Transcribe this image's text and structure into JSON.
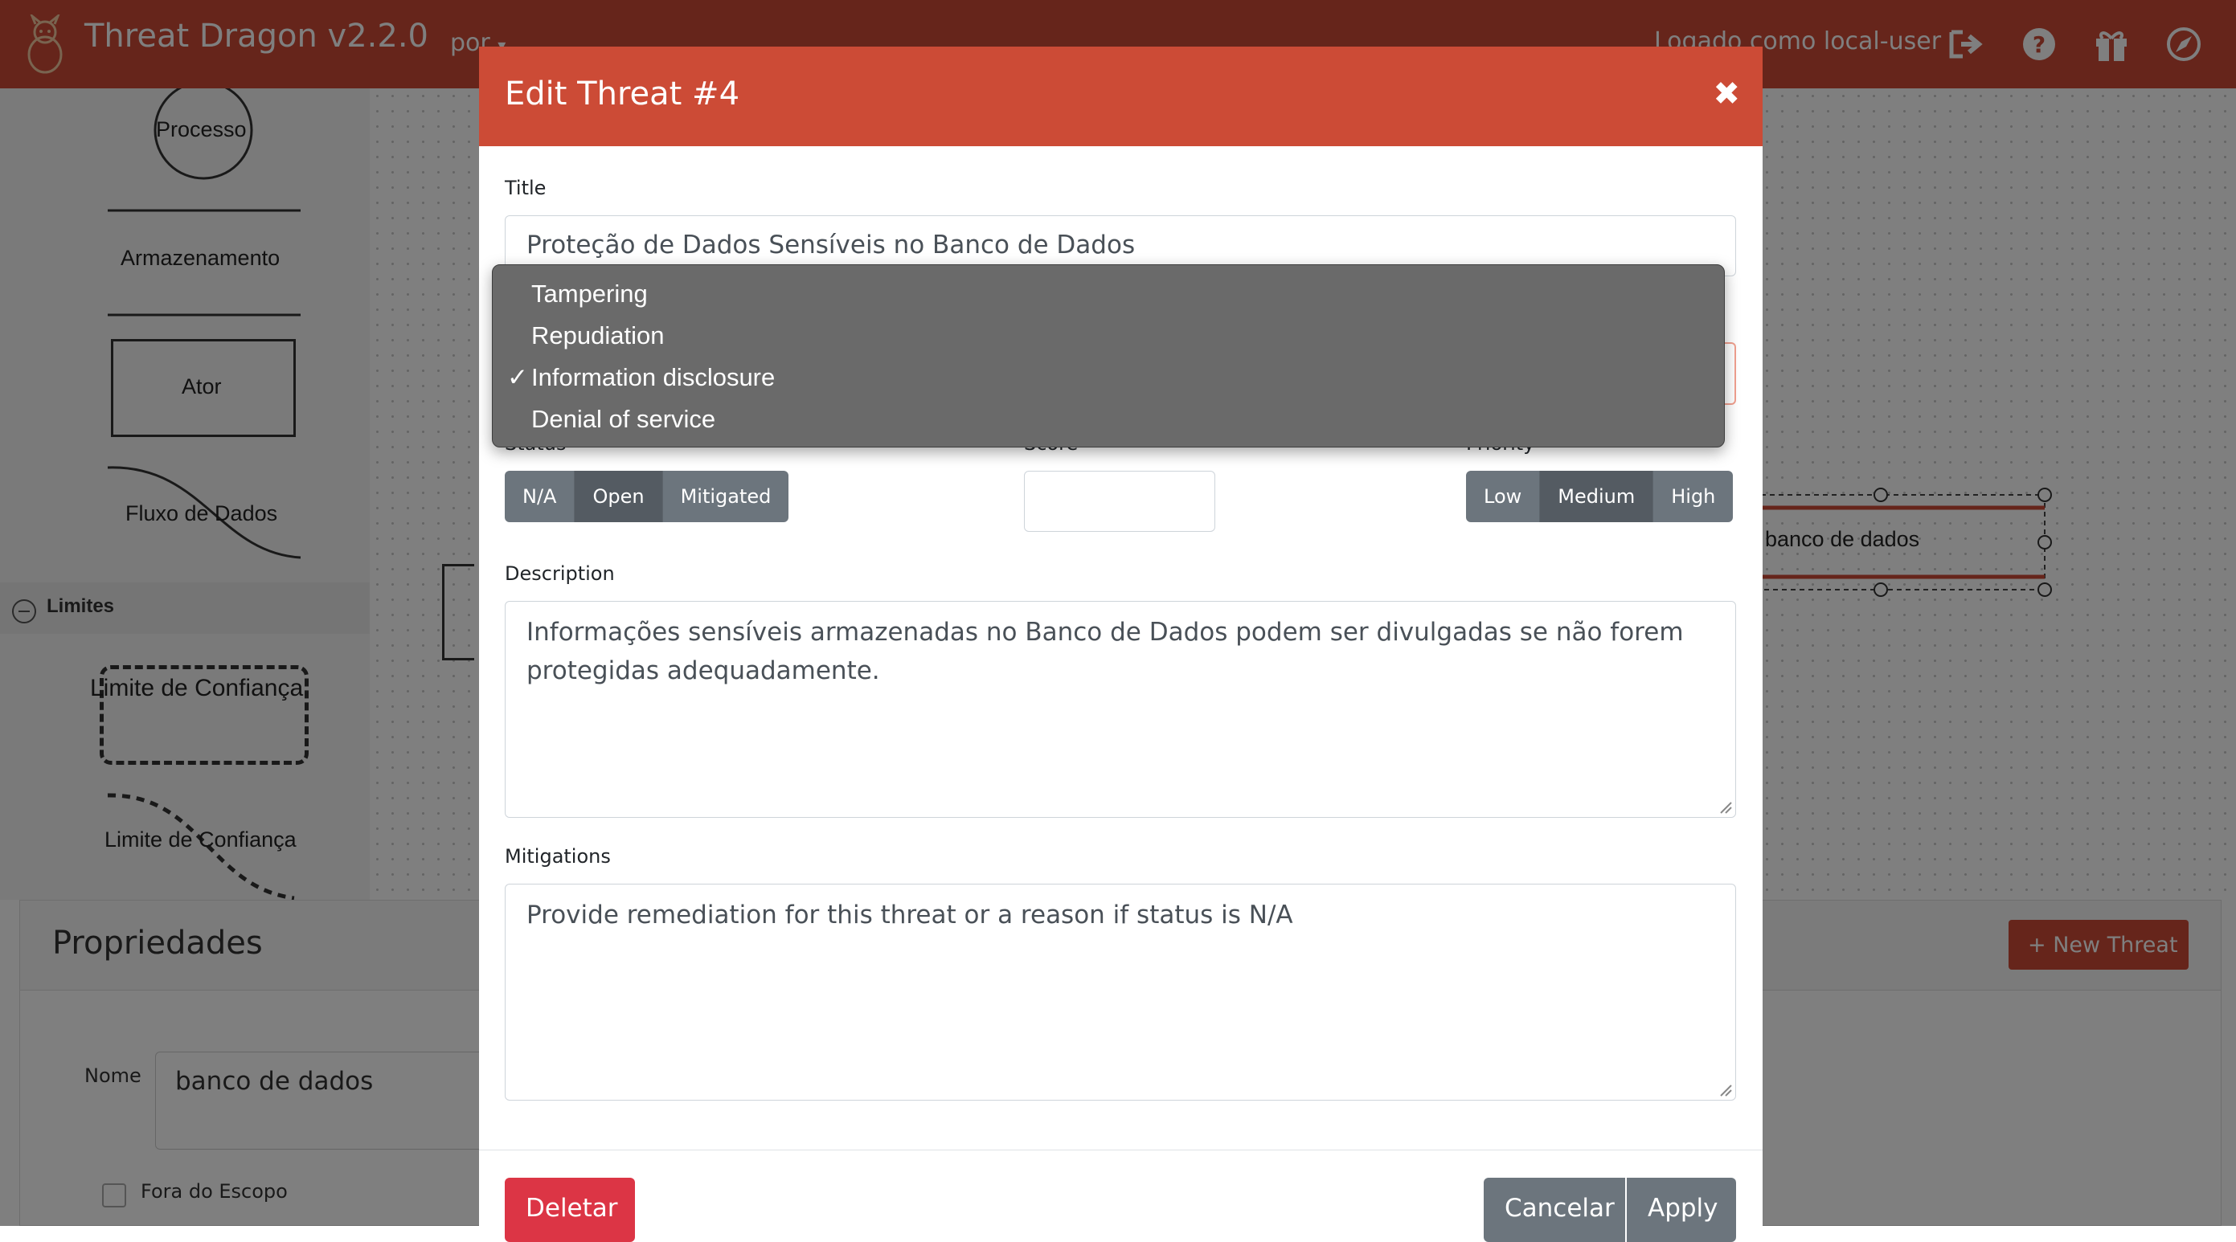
{
  "navbar": {
    "brand": "Threat Dragon v2.2.0",
    "language": "por",
    "logged_in": "Logado como local-user",
    "icons": [
      "sign-out-icon",
      "help-icon",
      "gift-icon",
      "compass-icon"
    ],
    "color": "#cc4b36"
  },
  "stencil": {
    "items": [
      "Processo",
      "Armazenamento",
      "Ator",
      "Fluxo de Dados"
    ],
    "group": "Limites",
    "boundaries": [
      "Limite de Confiança",
      "Limite de Confiança"
    ]
  },
  "canvas": {
    "selected_store_label": "banco de dados"
  },
  "properties": {
    "title": "Propriedades",
    "new_threat_label": "New Threat",
    "name_label": "Nome",
    "name_value": "banco de dados",
    "out_of_scope_label": "Fora do Escopo"
  },
  "modal": {
    "title": "Edit Threat #4",
    "close_glyph": "✖",
    "title_label": "Title",
    "title_value": "Proteção de Dados Sensíveis no Banco de Dados",
    "type_options": [
      {
        "label": "Tampering",
        "checked": false
      },
      {
        "label": "Repudiation",
        "checked": false
      },
      {
        "label": "Information disclosure",
        "checked": true
      },
      {
        "label": "Denial of service",
        "checked": false
      }
    ],
    "check_glyph": "✓",
    "status_label": "Status",
    "status_buttons": [
      "N/A",
      "Open",
      "Mitigated"
    ],
    "status_active": "Open",
    "score_label": "Score",
    "score_value": "",
    "priority_label": "Priority",
    "priority_buttons": [
      "Low",
      "Medium",
      "High"
    ],
    "priority_active": "Medium",
    "description_label": "Description",
    "description_value": "Informações sensíveis armazenadas no Banco de Dados podem ser divulgadas se não forem protegidas adequadamente.",
    "mitigations_label": "Mitigations",
    "mitigations_value": "Provide remediation for this threat or a reason if status is N/A",
    "delete_label": "Deletar",
    "cancel_label": "Cancelar",
    "apply_label": "Apply"
  }
}
